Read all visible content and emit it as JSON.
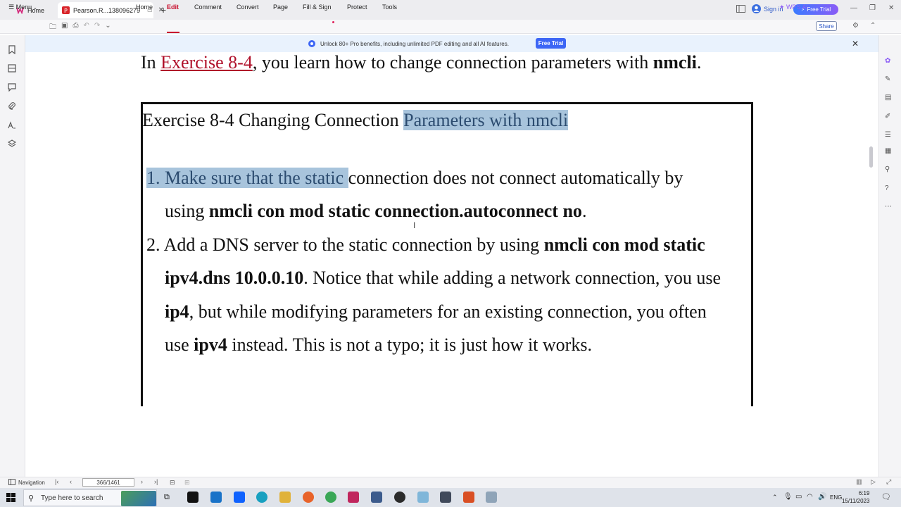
{
  "titlebar": {
    "tabs": [
      {
        "label": "Home"
      },
      {
        "label": "Pearson.R...138096279"
      }
    ],
    "add_tab": "+",
    "sign_in": "Sign in",
    "free_trial": "Free Trial"
  },
  "menubar": {
    "menu_label": "Menu",
    "items": [
      "Home",
      "Edit",
      "Comment",
      "Convert",
      "Page",
      "Fill & Sign",
      "Protect",
      "Tools"
    ],
    "active": "Edit",
    "wps_ai": "WPS AI",
    "share": "Share"
  },
  "banner": {
    "text": "Unlock 80+ Pro benefits, including unlimited PDF editing and all AI features.",
    "button": "Free Trial"
  },
  "document": {
    "intro_pre": "In ",
    "intro_link": "Exercise 8-4",
    "intro_mid": ", you learn how to change connection parameters with ",
    "intro_bold": "nmcli",
    "intro_end": ".",
    "ex_title_plain": "Exercise 8-4 Changing Connection ",
    "ex_title_hl": "Parameters with nmcli",
    "step1_hl": "1. Make sure that the static ",
    "step1_rest": "connection does not connect automatically by",
    "step1b_pre": "using ",
    "step1b_cmd": "nmcli con mod static connection.autoconnect no",
    "step1b_end": ".",
    "step2_pre": "2. Add a DNS server to the static connection by using ",
    "step2_cmd": "nmcli con mod static",
    "step2b_cmd": "ipv4.dns 10.0.0.10",
    "step2b_rest": ". Notice that while adding a network connection, you use",
    "step2c_bold": "ip4",
    "step2c_rest": ", but while modifying parameters for an existing connection, you often",
    "step2d_pre": "use ",
    "step2d_bold": "ipv4",
    "step2d_rest": " instead. This is not a typo; it is just how it works."
  },
  "statusbar": {
    "navigation": "Navigation",
    "page": "366/1461"
  },
  "taskbar": {
    "search_placeholder": "Type here to search",
    "lang": "ENG",
    "time": "6:19",
    "date": "15/11/2023"
  },
  "colors": {
    "accent_red": "#c8102e",
    "highlight": "#a8c4dc",
    "banner_bg": "#e9f2fd",
    "trial_blue": "#3d66f5"
  }
}
